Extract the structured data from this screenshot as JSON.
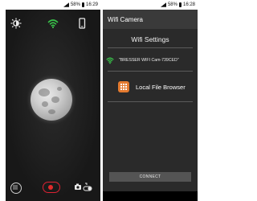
{
  "left_screen": {
    "status": {
      "battery_pct": "58%",
      "time": "16:29"
    }
  },
  "right_screen": {
    "status": {
      "battery_pct": "58%",
      "time": "16:28"
    },
    "app_title": "Wifi Camera",
    "wifi_settings_title": "Wifi Settings",
    "network_name": "\"BRESSER WIFI Cam-739CED\"",
    "local_file_browser_label": "Local File Browser",
    "connect_label": "CONNECT"
  },
  "colors": {
    "wifi_green": "#39c24a",
    "record_red": "#e02b2b",
    "file_icon_orange": "#e47a2f"
  },
  "icons": [
    "brightness-icon",
    "wifi-icon",
    "phone-icon",
    "grid-icon",
    "record-icon",
    "camera-switch-icon",
    "wifi-signal-icon",
    "file-browser-icon"
  ]
}
